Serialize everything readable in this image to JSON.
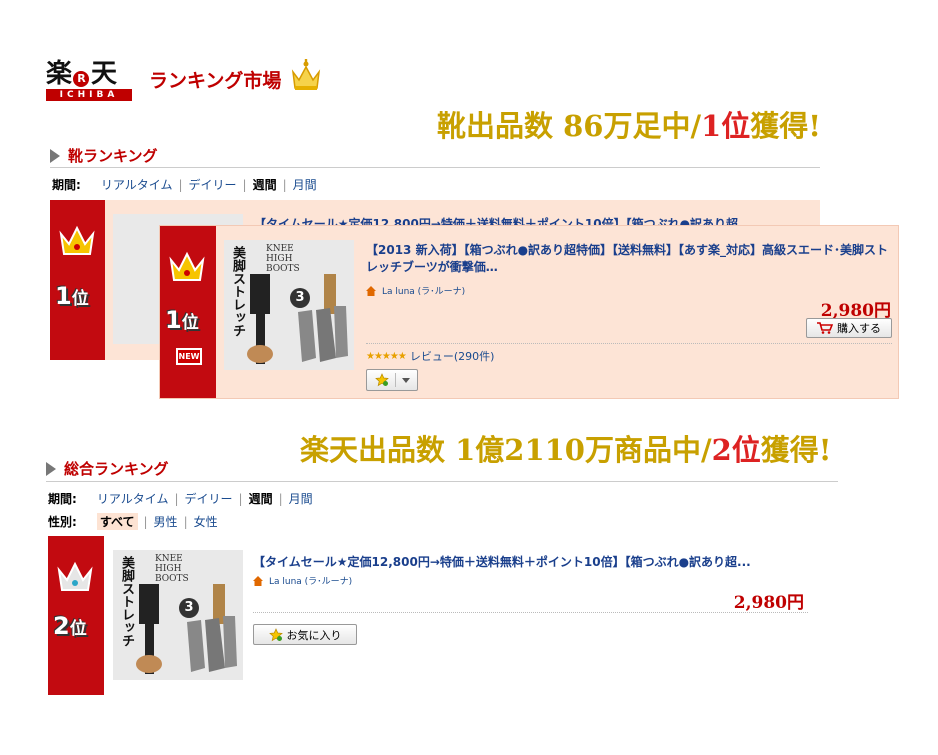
{
  "logo": {
    "top": "楽天",
    "mark": "R",
    "sub": "ICHIBA",
    "ranking_market": "ランキング市場"
  },
  "headline1": {
    "part1": "靴出品数 86万足中/",
    "rank": "1位",
    "part2": "獲得!"
  },
  "headline2": {
    "part1": "楽天出品数 1億2110万商品中/",
    "rank": "2位",
    "part2": "獲得!"
  },
  "shoe_section": {
    "title": "靴ランキング",
    "period_label": "期間:",
    "periods": [
      "リアルタイム",
      "デイリー",
      "週間",
      "月間"
    ],
    "back_title": "【タイムセール★定価12,800円→特価＋送料無料＋ポイント10倍】【箱つぶれ●訳あり超"
  },
  "card1": {
    "rank_num": "1",
    "rank_suffix": "位",
    "new_label": "NEW",
    "thumb_vertical": "美脚ストレッチ",
    "thumb_knee": [
      "KNEE",
      "HIGH",
      "BOOTS"
    ],
    "thumb_count": "3",
    "title": "【2013 新入荷】【箱つぶれ●訳あり超特価】【送料無料】【あす楽_対応】高級スエード･美脚ストレッチブーツが衝撃価…",
    "shop": "La luna (ラ･ルーナ)",
    "price": "2,980円",
    "buy_label": "購入する",
    "stars": "★★★★★",
    "review": "レビュー(290件)"
  },
  "overall_section": {
    "title": "総合ランキング",
    "period_label": "期間:",
    "periods": [
      "リアルタイム",
      "デイリー",
      "週間",
      "月間"
    ],
    "gender_label": "性別:",
    "genders": [
      "すべて",
      "男性",
      "女性"
    ]
  },
  "card2": {
    "rank_num": "2",
    "rank_suffix": "位",
    "thumb_vertical": "美脚ストレッチ",
    "thumb_knee": [
      "KNEE",
      "HIGH",
      "BOOTS"
    ],
    "thumb_count": "3",
    "title": "【タイムセール★定価12,800円→特価＋送料無料＋ポイント10倍】【箱つぶれ●訳あり超...",
    "shop": "La luna (ラ･ルーナ)",
    "price": "2,980円",
    "fav_label": "お気に入り"
  },
  "colors": {
    "brand_red": "#bf0000",
    "gold": "#c8a000",
    "card_bg": "#fde4d6",
    "link_blue": "#1a4b8f"
  }
}
